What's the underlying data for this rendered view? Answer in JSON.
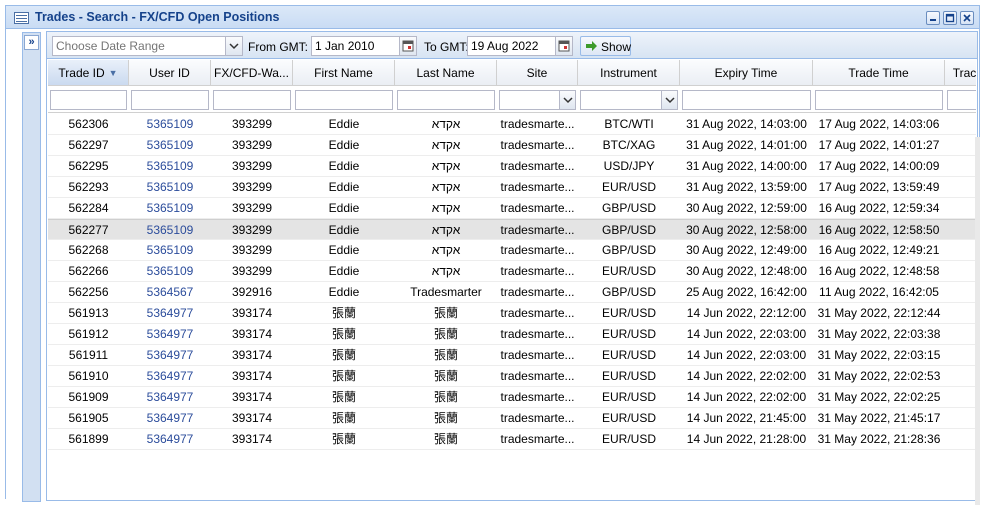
{
  "window": {
    "title": "Trades - Search - FX/CFD Open Positions"
  },
  "toolbar": {
    "date_range_placeholder": "Choose Date Range",
    "from_label": "From GMT:",
    "from_value": "1 Jan 2010",
    "to_label": "To GMT:",
    "to_value": "19 Aug 2022",
    "show_label": "Show"
  },
  "grid": {
    "columns": [
      "Trade ID",
      "User ID",
      "FX/CFD-Wa...",
      "First Name",
      "Last Name",
      "Site",
      "Instrument",
      "Expiry Time",
      "Trade Time",
      "Trac"
    ],
    "rows": [
      [
        "562306",
        "5365109",
        "393299",
        "Eddie",
        "אקדא",
        "tradesmarte...",
        "BTC/WTI",
        "31 Aug 2022, 14:03:00",
        "17 Aug 2022, 14:03:06"
      ],
      [
        "562297",
        "5365109",
        "393299",
        "Eddie",
        "אקדא",
        "tradesmarte...",
        "BTC/XAG",
        "31 Aug 2022, 14:01:00",
        "17 Aug 2022, 14:01:27"
      ],
      [
        "562295",
        "5365109",
        "393299",
        "Eddie",
        "אקדא",
        "tradesmarte...",
        "USD/JPY",
        "31 Aug 2022, 14:00:00",
        "17 Aug 2022, 14:00:09"
      ],
      [
        "562293",
        "5365109",
        "393299",
        "Eddie",
        "אקדא",
        "tradesmarte...",
        "EUR/USD",
        "31 Aug 2022, 13:59:00",
        "17 Aug 2022, 13:59:49"
      ],
      [
        "562284",
        "5365109",
        "393299",
        "Eddie",
        "אקדא",
        "tradesmarte...",
        "GBP/USD",
        "30 Aug 2022, 12:59:00",
        "16 Aug 2022, 12:59:34"
      ],
      [
        "562277",
        "5365109",
        "393299",
        "Eddie",
        "אקדא",
        "tradesmarte...",
        "GBP/USD",
        "30 Aug 2022, 12:58:00",
        "16 Aug 2022, 12:58:50"
      ],
      [
        "562268",
        "5365109",
        "393299",
        "Eddie",
        "אקדא",
        "tradesmarte...",
        "GBP/USD",
        "30 Aug 2022, 12:49:00",
        "16 Aug 2022, 12:49:21"
      ],
      [
        "562266",
        "5365109",
        "393299",
        "Eddie",
        "אקדא",
        "tradesmarte...",
        "EUR/USD",
        "30 Aug 2022, 12:48:00",
        "16 Aug 2022, 12:48:58"
      ],
      [
        "562256",
        "5364567",
        "392916",
        "Eddie",
        "Tradesmarter",
        "tradesmarte...",
        "GBP/USD",
        "25 Aug 2022, 16:42:00",
        "11 Aug 2022, 16:42:05"
      ],
      [
        "561913",
        "5364977",
        "393174",
        "張蘭",
        "張蘭",
        "tradesmarte...",
        "EUR/USD",
        "14 Jun 2022, 22:12:00",
        "31 May 2022, 22:12:44"
      ],
      [
        "561912",
        "5364977",
        "393174",
        "張蘭",
        "張蘭",
        "tradesmarte...",
        "EUR/USD",
        "14 Jun 2022, 22:03:00",
        "31 May 2022, 22:03:38"
      ],
      [
        "561911",
        "5364977",
        "393174",
        "張蘭",
        "張蘭",
        "tradesmarte...",
        "EUR/USD",
        "14 Jun 2022, 22:03:00",
        "31 May 2022, 22:03:15"
      ],
      [
        "561910",
        "5364977",
        "393174",
        "張蘭",
        "張蘭",
        "tradesmarte...",
        "EUR/USD",
        "14 Jun 2022, 22:02:00",
        "31 May 2022, 22:02:53"
      ],
      [
        "561909",
        "5364977",
        "393174",
        "張蘭",
        "張蘭",
        "tradesmarte...",
        "EUR/USD",
        "14 Jun 2022, 22:02:00",
        "31 May 2022, 22:02:25"
      ],
      [
        "561905",
        "5364977",
        "393174",
        "張蘭",
        "張蘭",
        "tradesmarte...",
        "EUR/USD",
        "14 Jun 2022, 21:45:00",
        "31 May 2022, 21:45:17"
      ],
      [
        "561899",
        "5364977",
        "393174",
        "張蘭",
        "張蘭",
        "tradesmarte...",
        "EUR/USD",
        "14 Jun 2022, 21:28:00",
        "31 May 2022, 21:28:36"
      ]
    ],
    "selected_row_index": 5,
    "sorted_column": "Trade ID",
    "sort_direction": "descending"
  },
  "colors": {
    "title_text": "#15428b",
    "link": "#2b4c9b",
    "border": "#99bbe8"
  }
}
